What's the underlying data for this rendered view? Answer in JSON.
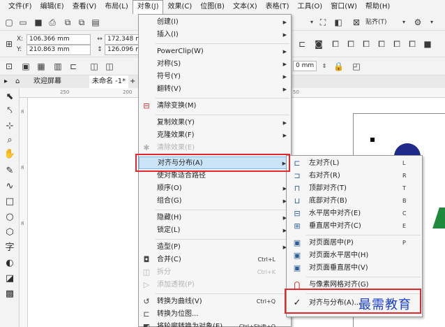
{
  "menubar": {
    "items": [
      "文件(F)",
      "编辑(E)",
      "查看(V)",
      "布局(L)",
      "对象(J)",
      "效果(C)",
      "位图(B)",
      "文本(X)",
      "表格(T)",
      "工具(O)",
      "窗口(W)",
      "帮助(H)"
    ]
  },
  "toolbar": {
    "snap_label": "贴齐(T)",
    "x_label": "X:",
    "x_value": "106.366 mm",
    "y_label": "Y:",
    "y_value": "210.863 mm",
    "w_value": "172.348 m",
    "h_value": "126.096 m",
    "outline_value": "0 mm"
  },
  "tabs": {
    "welcome": "欢迎屏幕",
    "doc": "未命名 -1*"
  },
  "ruler": {
    "top_ticks": [
      "250",
      "200",
      "50"
    ],
    "left_ticks": [
      "8",
      "8",
      "8"
    ]
  },
  "object_menu": {
    "items": [
      {
        "label": "创建(I)",
        "arrow": true
      },
      {
        "label": "插入(I)",
        "arrow": true
      },
      {
        "label": "PowerClip(W)",
        "arrow": true
      },
      {
        "label": "对称(S)",
        "arrow": true
      },
      {
        "label": "符号(Y)",
        "arrow": true
      },
      {
        "label": "翻转(V)",
        "arrow": true
      },
      {
        "label": "清除变换(M)"
      },
      {
        "label": "复制效果(Y)",
        "arrow": true
      },
      {
        "label": "克隆效果(F)",
        "arrow": true
      },
      {
        "label": "清除效果(E)",
        "disabled": true
      },
      {
        "label": "对齐与分布(A)",
        "arrow": true,
        "highlight": true
      },
      {
        "label": "使对象适合路径"
      },
      {
        "label": "顺序(O)",
        "arrow": true
      },
      {
        "label": "组合(G)",
        "arrow": true
      },
      {
        "label": "隐藏(H)",
        "arrow": true
      },
      {
        "label": "锁定(L)",
        "arrow": true
      },
      {
        "label": "造型(P)",
        "arrow": true
      },
      {
        "label": "合并(C)",
        "shortcut": "Ctrl+L"
      },
      {
        "label": "拆分",
        "shortcut": "Ctrl+K",
        "disabled": true
      },
      {
        "label": "添加透视(P)",
        "disabled": true
      },
      {
        "label": "转换为曲线(V)",
        "shortcut": "Ctrl+Q"
      },
      {
        "label": "转换为位图..."
      },
      {
        "label": "将轮廓转换为对象(E)",
        "shortcut": "Ctrl+Shift+Q"
      }
    ]
  },
  "align_submenu": {
    "items": [
      {
        "label": "左对齐(L)",
        "shortcut": "L"
      },
      {
        "label": "右对齐(R)",
        "shortcut": "R"
      },
      {
        "label": "顶部对齐(T)",
        "shortcut": "T"
      },
      {
        "label": "底部对齐(B)",
        "shortcut": "B"
      },
      {
        "label": "水平居中对齐(E)",
        "shortcut": "C"
      },
      {
        "label": "垂直居中对齐(C)",
        "shortcut": "E"
      },
      {
        "label": "对页面居中(P)",
        "shortcut": "P"
      },
      {
        "label": "对页面水平居中(H)"
      },
      {
        "label": "对页面垂直居中(V)"
      },
      {
        "label": "与像素网格对齐(G)"
      },
      {
        "label": "对齐与分布(A)..."
      }
    ]
  },
  "watermark": "最需教育",
  "colors": {
    "highlight": "#cce4f7",
    "highlight_border": "#7eb4ea",
    "annotation_red": "#e0282e",
    "shape_navy": "#1f2a8a",
    "shape_green": "#1e8a3c"
  }
}
